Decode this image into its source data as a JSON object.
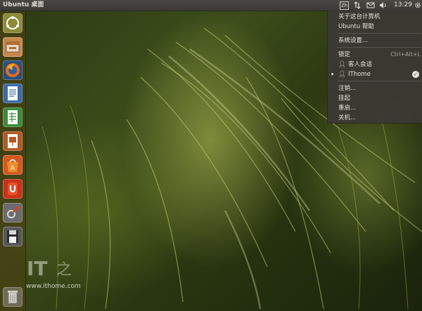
{
  "panel": {
    "title": "Ubuntu 桌面",
    "keyboard": "Zh",
    "clock": "13:29"
  },
  "launcher": {
    "items": [
      {
        "name": "dash-home",
        "icon": "ubuntu-logo-icon"
      },
      {
        "name": "files",
        "icon": "file-manager-icon"
      },
      {
        "name": "firefox",
        "icon": "firefox-icon"
      },
      {
        "name": "libreoffice-writer",
        "icon": "writer-icon"
      },
      {
        "name": "libreoffice-calc",
        "icon": "calc-icon"
      },
      {
        "name": "libreoffice-impress",
        "icon": "impress-icon"
      },
      {
        "name": "software-center",
        "icon": "software-center-icon"
      },
      {
        "name": "ubuntu-one",
        "icon": "ubuntu-one-icon"
      },
      {
        "name": "system-settings",
        "icon": "settings-icon"
      },
      {
        "name": "save",
        "icon": "floppy-icon"
      },
      {
        "name": "trash",
        "icon": "trash-icon"
      }
    ]
  },
  "menu": {
    "about": "关于这台计算机",
    "help": "Ubuntu 帮助",
    "settings": "系统设置...",
    "lock": "锁定",
    "lock_shortcut": "Ctrl+Alt+L",
    "guest": "客人会话",
    "user": "IThome",
    "logout": "注销...",
    "suspend": "挂起",
    "restart": "重启...",
    "shutdown": "关机..."
  },
  "watermark": {
    "url": "www.ithome.com"
  }
}
